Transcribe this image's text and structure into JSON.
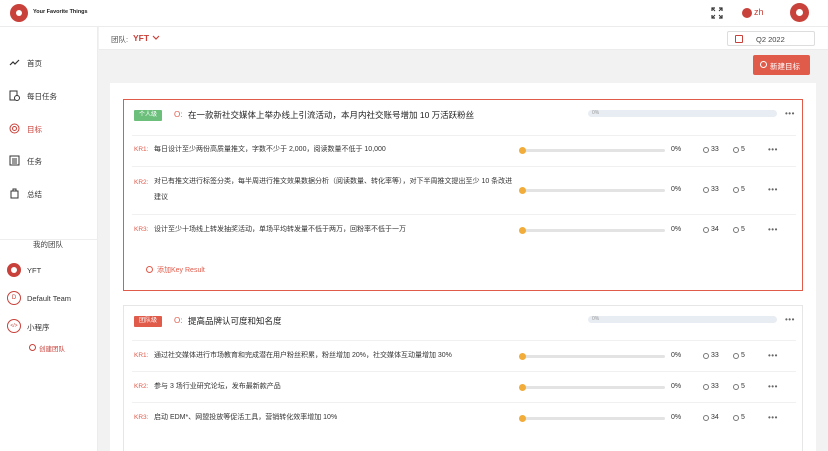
{
  "app": {
    "brand": "Your Favorite Things",
    "lang": "zh"
  },
  "sidebar": {
    "items": [
      {
        "label": "首页",
        "icon": "trend-icon"
      },
      {
        "label": "每日任务",
        "icon": "daily-task-icon"
      },
      {
        "label": "目标",
        "icon": "target-icon",
        "active": true
      },
      {
        "label": "任务",
        "icon": "task-list-icon"
      },
      {
        "label": "总结",
        "icon": "summary-icon"
      }
    ],
    "team_title": "我的团队",
    "teams": [
      {
        "label": "YFT",
        "badge": ""
      },
      {
        "label": "Default Team",
        "badge": "D"
      },
      {
        "label": "小程序",
        "badge": "</>"
      }
    ],
    "create_team": "创建团队"
  },
  "subbar": {
    "team_label": "团队:",
    "team_value": "YFT",
    "quarter": "Q2  2022"
  },
  "actions": {
    "new_objective": "新建目标"
  },
  "objectives": [
    {
      "level": "个人级",
      "prefix": "O:",
      "title": "在一款新社交媒体上举办线上引流活动，本月内社交账号增加 10 万活跃粉丝",
      "progress_text": "0%",
      "key_results": [
        {
          "label": "KR1:",
          "text": "每日设计至少两份高质量推文，字数不少于 2,000，阅读数量不低于 10,000",
          "percent": "0%",
          "time": "33",
          "comments": "5"
        },
        {
          "label": "KR2:",
          "text": "对已有推文进行标签分类，每半周进行推文效果数据分析（阅读数量、转化率等），对下半周推文提出至少 10 条改进建议",
          "percent": "0%",
          "time": "33",
          "comments": "5"
        },
        {
          "label": "KR3:",
          "text": "设计至少十场线上转发抽奖活动，单场平均转发量不低于两万，回粉率不低于一万",
          "percent": "0%",
          "time": "34",
          "comments": "5"
        }
      ],
      "add_kr": "添加Key Result"
    },
    {
      "level": "团队级",
      "prefix": "O:",
      "title": "提高品牌认可度和知名度",
      "progress_text": "0%",
      "key_results": [
        {
          "label": "KR1:",
          "text": "通过社交媒体进行市场教育和完成潜在用户粉丝积累，粉丝增加 20%，社交媒体互动量增加 30%",
          "percent": "0%",
          "time": "33",
          "comments": "5"
        },
        {
          "label": "KR2:",
          "text": "参与 3 场行业研究论坛，发布最新款产品",
          "percent": "0%",
          "time": "33",
          "comments": "5"
        },
        {
          "label": "KR3:",
          "text": "启动 EDM*、网盟投放等促活工具，营销转化效率增加 10%",
          "percent": "0%",
          "time": "34",
          "comments": "5"
        }
      ]
    }
  ]
}
